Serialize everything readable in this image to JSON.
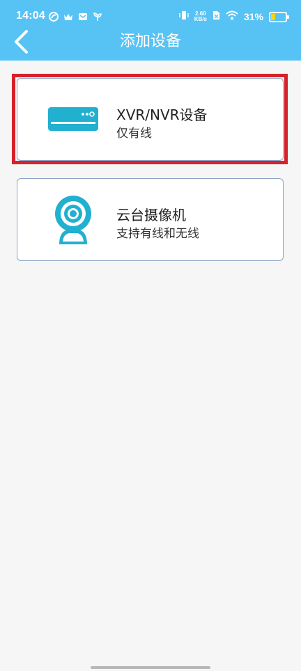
{
  "status_bar": {
    "time": "14:04",
    "net_speed_value": "2.60",
    "net_speed_unit": "KB/s",
    "battery_percent": "31%",
    "battery_level": 0.31,
    "left_icons": [
      "pinwheel-icon",
      "crown-icon",
      "mail-icon",
      "plant-icon"
    ],
    "right_icons": [
      "vibrate-icon",
      "netspeed-indicator",
      "sim-off-icon",
      "wifi-icon",
      "battery-icon"
    ]
  },
  "header": {
    "title": "添加设备",
    "back_icon": "back-chevron-icon",
    "background": "#57c3f5"
  },
  "devices": [
    {
      "title": "XVR/NVR设备",
      "subtitle": "仅有线",
      "icon": "nvr-recorder-icon",
      "highlighted": true
    },
    {
      "title": "云台摄像机",
      "subtitle": "支持有线和无线",
      "icon": "webcam-icon",
      "highlighted": false
    }
  ],
  "colors": {
    "accent": "#21b0d0",
    "highlight": "#d6222b",
    "card_border": "#8aa3c9"
  }
}
